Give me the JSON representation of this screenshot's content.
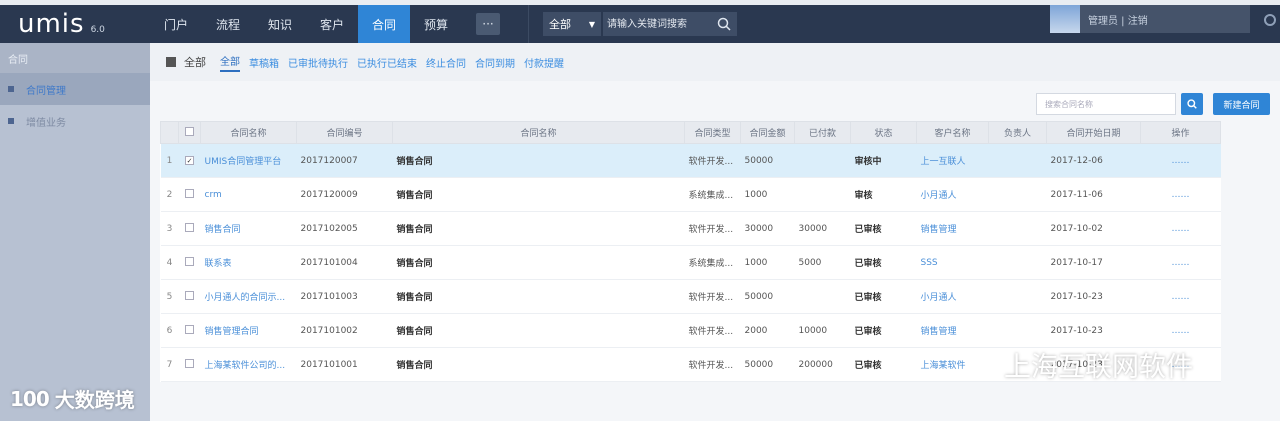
{
  "app": {
    "logo": "umis",
    "version": "6.0"
  },
  "nav": {
    "items": [
      "门户",
      "流程",
      "知识",
      "客户",
      "合同",
      "预算"
    ],
    "active_index": 4,
    "more_label": "···"
  },
  "search": {
    "scope": "全部",
    "placeholder": "请输入关键词搜索"
  },
  "user": {
    "name": "管理员 | 注销"
  },
  "sidebar": {
    "header": "合同",
    "items": [
      "合同管理",
      "增值业务"
    ],
    "active_index": 0
  },
  "breadcrumb": {
    "root": "全部"
  },
  "tabs": [
    "全部",
    "草稿箱",
    "已审批待执行",
    "已执行已结束",
    "终止合同",
    "合同到期",
    "付款提醒"
  ],
  "toolbar": {
    "filter_placeholder": "搜索合同名称",
    "new_button": "新建合同"
  },
  "table": {
    "columns": [
      "",
      "合同名称",
      "合同编号",
      "合同名称",
      "合同类型",
      "合同金额",
      "已付款",
      "状态",
      "客户名称",
      "负责人",
      "合同开始日期",
      "操作"
    ],
    "rows": [
      {
        "n": "1",
        "checked": true,
        "name": "UMIS合同管理平台",
        "code": "2017120007",
        "party": "销售合同",
        "type": "软件开发...",
        "amount": "50000",
        "paid": "",
        "status": "审核中",
        "client": "上一互联人",
        "owner": "",
        "date": "2017-12-06",
        "op": "……"
      },
      {
        "n": "2",
        "checked": false,
        "name": "crm",
        "code": "2017120009",
        "party": "销售合同",
        "type": "系统集成...",
        "amount": "1000",
        "paid": "",
        "status": "审核",
        "client": "小月通人",
        "owner": "",
        "date": "2017-11-06",
        "op": "……"
      },
      {
        "n": "3",
        "checked": false,
        "name": "销售合同",
        "code": "2017102005",
        "party": "销售合同",
        "type": "软件开发...",
        "amount": "30000",
        "paid": "30000",
        "status": "已审核",
        "client": "销售管理",
        "owner": "",
        "date": "2017-10-02",
        "op": "……"
      },
      {
        "n": "4",
        "checked": false,
        "name": "联系表",
        "code": "2017101004",
        "party": "销售合同",
        "type": "系统集成...",
        "amount": "1000",
        "paid": "5000",
        "status": "已审核",
        "client": "SSS",
        "owner": "",
        "date": "2017-10-17",
        "op": "……"
      },
      {
        "n": "5",
        "checked": false,
        "name": "小月通人的合同示...",
        "code": "2017101003",
        "party": "销售合同",
        "type": "软件开发...",
        "amount": "50000",
        "paid": "",
        "status": "已审核",
        "client": "小月通人",
        "owner": "",
        "date": "2017-10-23",
        "op": "……"
      },
      {
        "n": "6",
        "checked": false,
        "name": "销售管理合同",
        "code": "2017101002",
        "party": "销售合同",
        "type": "软件开发...",
        "amount": "2000",
        "paid": "10000",
        "status": "已审核",
        "client": "销售管理",
        "owner": "",
        "date": "2017-10-23",
        "op": "……"
      },
      {
        "n": "7",
        "checked": false,
        "name": "上海某软件公司的...",
        "code": "2017101001",
        "party": "销售合同",
        "type": "软件开发...",
        "amount": "50000",
        "paid": "200000",
        "status": "已审核",
        "client": "上海某软件",
        "owner": "",
        "date": "2017-10-23",
        "op": "……"
      }
    ]
  },
  "watermarks": {
    "left": "大数跨境",
    "left_logo": "100",
    "right": "上海互联网软件"
  },
  "colors": {
    "topbar": "#2a3850",
    "accent": "#2f85d6",
    "sidebar": "#b7c1d2",
    "selected_row": "#dbeefa"
  }
}
